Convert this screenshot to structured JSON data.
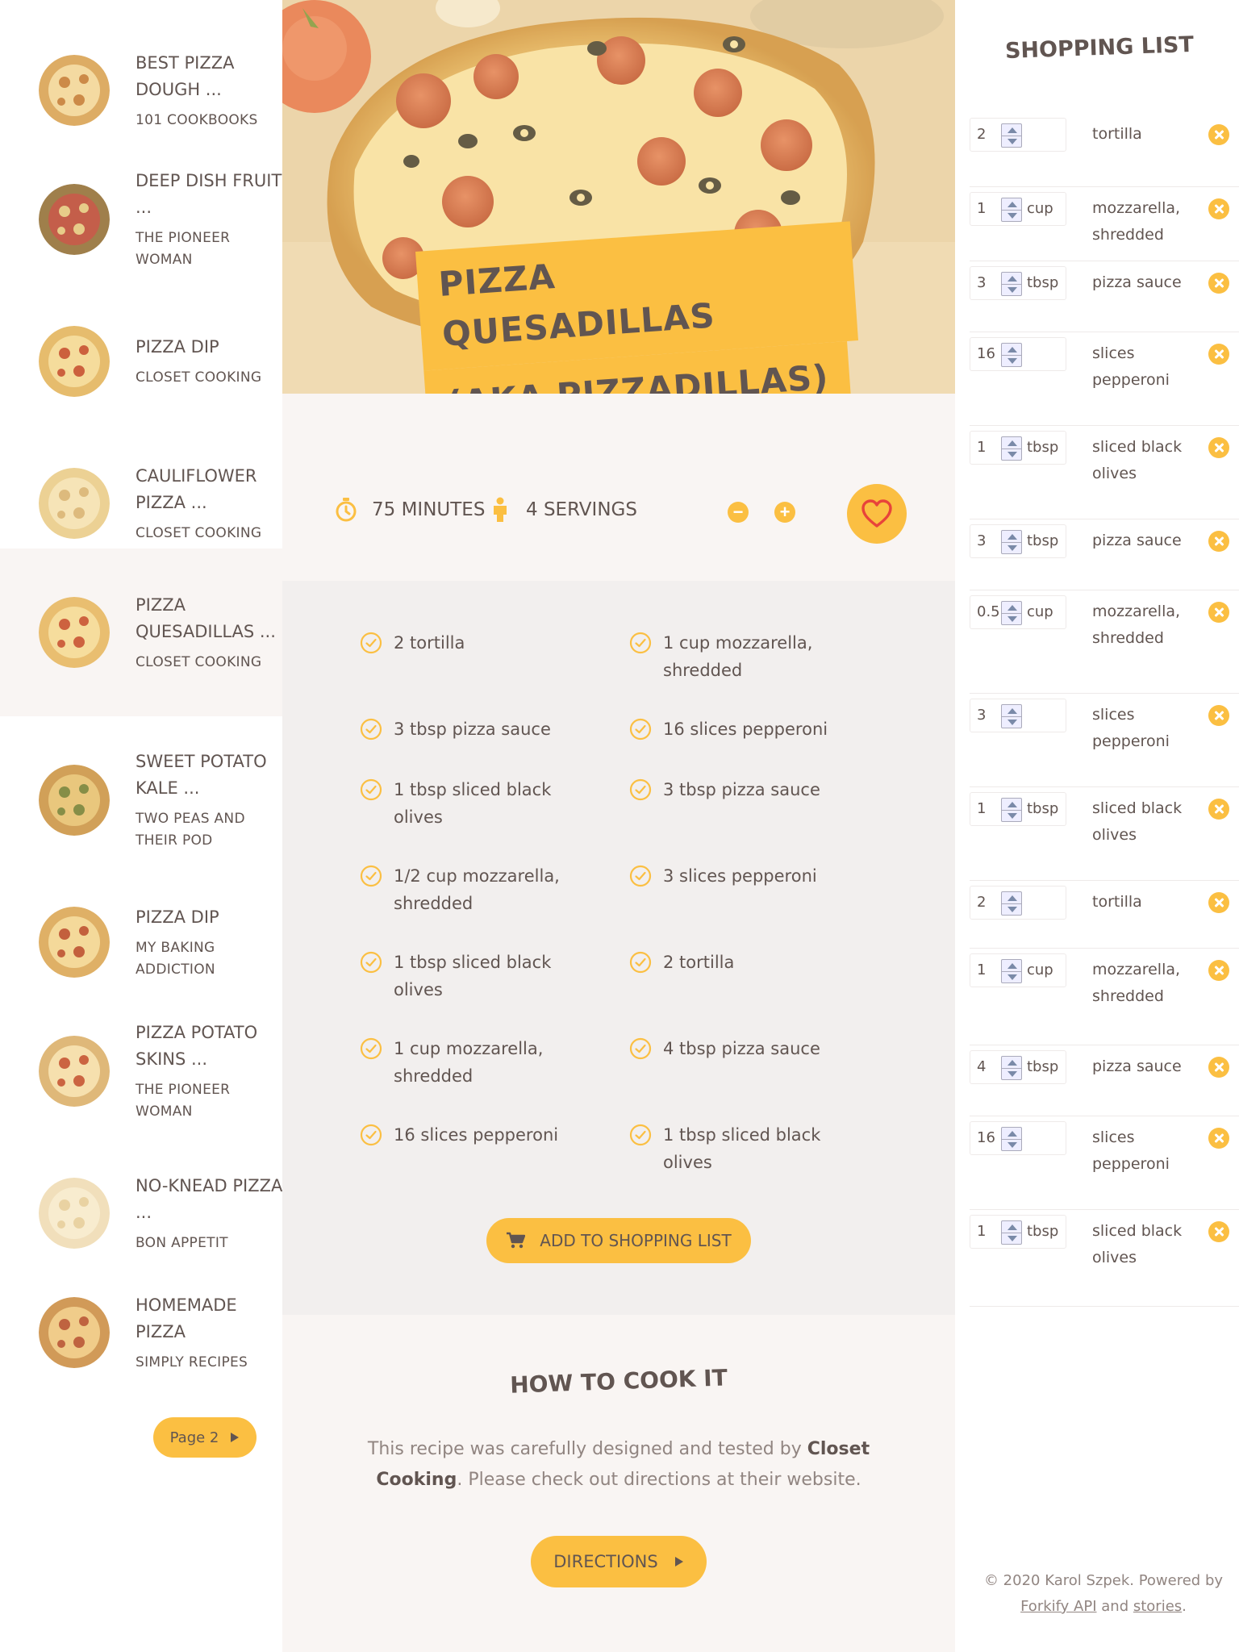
{
  "results": [
    {
      "title": "Best Pizza Dough ...",
      "publisher": "101 Cookbooks",
      "active": false
    },
    {
      "title": "Deep Dish Fruit ...",
      "publisher": "The Pioneer Woman",
      "active": false
    },
    {
      "title": "Pizza Dip",
      "publisher": "Closet Cooking",
      "active": false
    },
    {
      "title": "Cauliflower Pizza ...",
      "publisher": "Closet Cooking",
      "active": false
    },
    {
      "title": "Pizza Quesadillas ...",
      "publisher": "Closet Cooking",
      "active": true
    },
    {
      "title": "Sweet Potato Kale ...",
      "publisher": "Two Peas and Their Pod",
      "active": false
    },
    {
      "title": "Pizza Dip",
      "publisher": "My Baking Addiction",
      "active": false
    },
    {
      "title": "Pizza Potato Skins ...",
      "publisher": "The Pioneer Woman",
      "active": false
    },
    {
      "title": "No-Knead Pizza ...",
      "publisher": "Bon Appetit",
      "active": false
    },
    {
      "title": "Homemade Pizza",
      "publisher": "Simply Recipes",
      "active": false
    }
  ],
  "pagination": {
    "label": "Page 2"
  },
  "recipe": {
    "title_line1": "Pizza Quesadillas",
    "title_line2": "(Aka Pizzadillas)",
    "time": "75 minutes",
    "servings": "4 servings",
    "decrease_label": "−",
    "increase_label": "+",
    "ingredients": [
      "2 tortilla",
      "1 cup mozzarella, shredded",
      "3 tbsp pizza sauce",
      "16 slices pepperoni",
      "1 tbsp sliced black olives",
      "3 tbsp pizza sauce",
      "1/2 cup mozzarella, shredded",
      "3 slices pepperoni",
      "1 tbsp sliced black olives",
      "2 tortilla",
      "1 cup mozzarella, shredded",
      "4 tbsp pizza sauce",
      "16 slices pepperoni",
      "1 tbsp sliced black olives"
    ],
    "add_to_list_label": "Add to shopping list",
    "howto_title": "How to cook it",
    "howto_text_before": "This recipe was carefully designed and tested by ",
    "howto_publisher": "Closet Cooking",
    "howto_text_after": ". Please check out directions at their website.",
    "directions_label": "Directions"
  },
  "shopping_list": {
    "title": "Shopping List",
    "items": [
      {
        "count": "2",
        "unit": "",
        "name": "tortilla"
      },
      {
        "count": "1",
        "unit": "cup",
        "name": "mozzarella, shredded"
      },
      {
        "count": "3",
        "unit": "tbsp",
        "name": "pizza sauce"
      },
      {
        "count": "16",
        "unit": "",
        "name": "slices pepperoni"
      },
      {
        "count": "1",
        "unit": "tbsp",
        "name": "sliced black olives"
      },
      {
        "count": "3",
        "unit": "tbsp",
        "name": "pizza sauce"
      },
      {
        "count": "0.5",
        "unit": "cup",
        "name": "mozzarella, shredded"
      },
      {
        "count": "3",
        "unit": "",
        "name": "slices pepperoni"
      },
      {
        "count": "1",
        "unit": "tbsp",
        "name": "sliced black olives"
      },
      {
        "count": "2",
        "unit": "",
        "name": "tortilla"
      },
      {
        "count": "1",
        "unit": "cup",
        "name": "mozzarella, shredded"
      },
      {
        "count": "4",
        "unit": "tbsp",
        "name": "pizza sauce"
      },
      {
        "count": "16",
        "unit": "",
        "name": "slices pepperoni"
      },
      {
        "count": "1",
        "unit": "tbsp",
        "name": "sliced black olives"
      }
    ]
  },
  "footer": {
    "copyright_text": "© 2020 Karol Szpek. Powered by",
    "link1": "Forkify API",
    "and_text": "and",
    "link2": "stories",
    "period": "."
  },
  "colors": {
    "accent": "#fbbf42",
    "text": "#615551",
    "muted": "#918581",
    "background": "#f9f5f3",
    "grey": "#f2efee"
  },
  "icons": [
    "stopwatch-icon",
    "person-icon",
    "minus-circle-icon",
    "plus-circle-icon",
    "heart-icon",
    "check-circle-icon",
    "cart-icon",
    "arrow-right-icon",
    "close-circle-icon",
    "spinner-arrows-icon"
  ]
}
